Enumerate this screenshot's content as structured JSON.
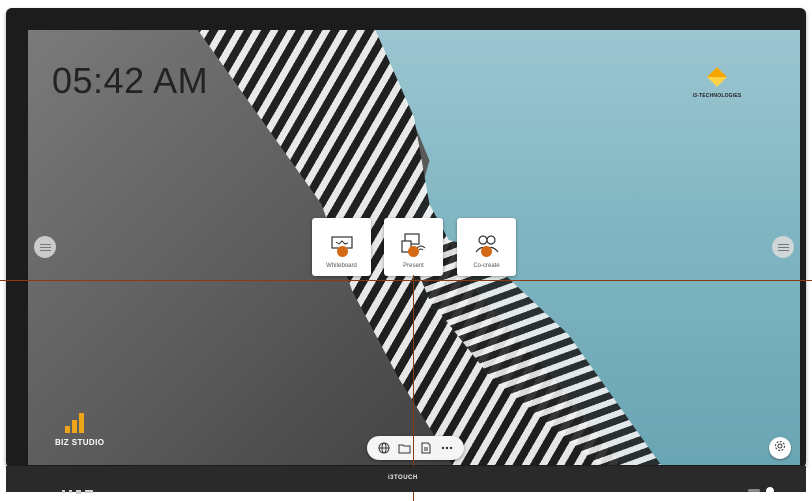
{
  "clock": {
    "time": "05:42 AM"
  },
  "brand": {
    "name": "i3-TECHNOLOGIES",
    "accent": "#f7a600"
  },
  "tiles": [
    {
      "label": "Whiteboard",
      "icon": "whiteboard-icon"
    },
    {
      "label": "Present",
      "icon": "present-icon"
    },
    {
      "label": "Co-create",
      "icon": "co-create-icon"
    }
  ],
  "dock": {
    "icons": [
      "globe-icon",
      "folder-icon",
      "document-icon",
      "more-icon"
    ]
  },
  "biz_studio": {
    "label": "BIZ STUDIO"
  },
  "chin": {
    "label": "i3TOUCH"
  },
  "overlay": {
    "line_color": "#8a3b10",
    "dot_color": "#d46a16"
  }
}
